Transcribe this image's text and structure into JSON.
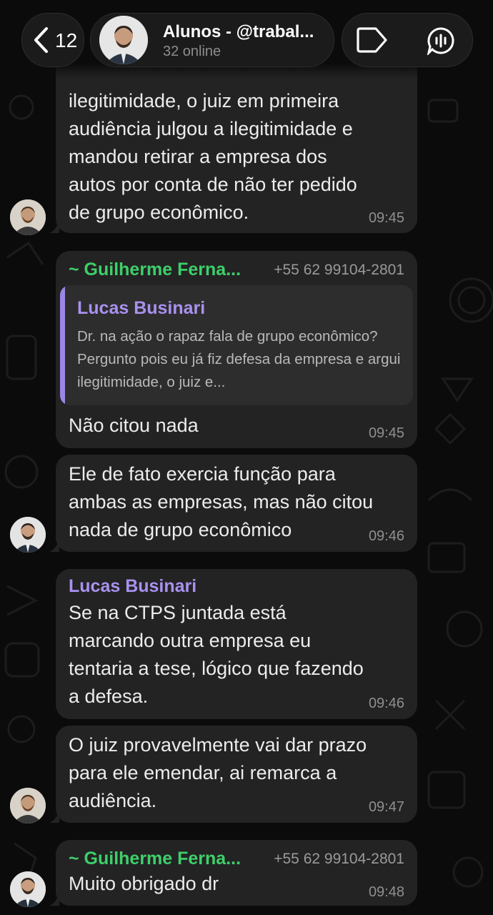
{
  "header": {
    "back_count": "12",
    "title": "Alunos - @trabal...",
    "subtitle": "32 online",
    "icons": [
      "chevron-left-icon",
      "tag-icon",
      "voice-chat-icon"
    ]
  },
  "colors": {
    "background": "#0b0b0b",
    "bubble": "#232323",
    "quote_bg": "#2d2d2d",
    "green_sender": "#3ecf6a",
    "purple_sender": "#a991f0",
    "timestamp": "#8f8f8f"
  },
  "messages": [
    {
      "id": "m1",
      "text_lines": [
        "ilegitimidade, o juiz em primeira",
        "audiência julgou a ilegitimidade e",
        "mandou retirar a empresa dos",
        "autos por conta de não ter pedido",
        "de grupo econômico."
      ],
      "time": "09:45"
    },
    {
      "id": "m2",
      "sender": "~ Guilherme Ferna...",
      "phone": "+55 62 99104-2801",
      "quote": {
        "name": "Lucas Businari",
        "text": "Dr. na ação o rapaz fala de grupo econômico? Pergunto pois eu já fiz defesa da empresa e argui ilegitimidade, o juiz e..."
      },
      "text": "Não citou nada",
      "time": "09:45"
    },
    {
      "id": "m3",
      "text_lines": [
        "Ele de fato exercia função para",
        "ambas as empresas, mas não citou",
        "nada de grupo econômico"
      ],
      "time": "09:46"
    },
    {
      "id": "m4",
      "sender": "Lucas Businari",
      "text_lines": [
        "Se na CTPS juntada está",
        "marcando outra empresa eu",
        "tentaria a tese, lógico que fazendo",
        "a defesa."
      ],
      "time": "09:46"
    },
    {
      "id": "m5",
      "text_lines": [
        "O juiz provavelmente vai dar prazo",
        "para ele emendar, ai remarca a",
        "audiência."
      ],
      "time": "09:47"
    },
    {
      "id": "m6",
      "sender": "~ Guilherme Ferna...",
      "phone": "+55 62 99104-2801",
      "text": "Muito obrigado dr",
      "time": "09:48"
    }
  ]
}
